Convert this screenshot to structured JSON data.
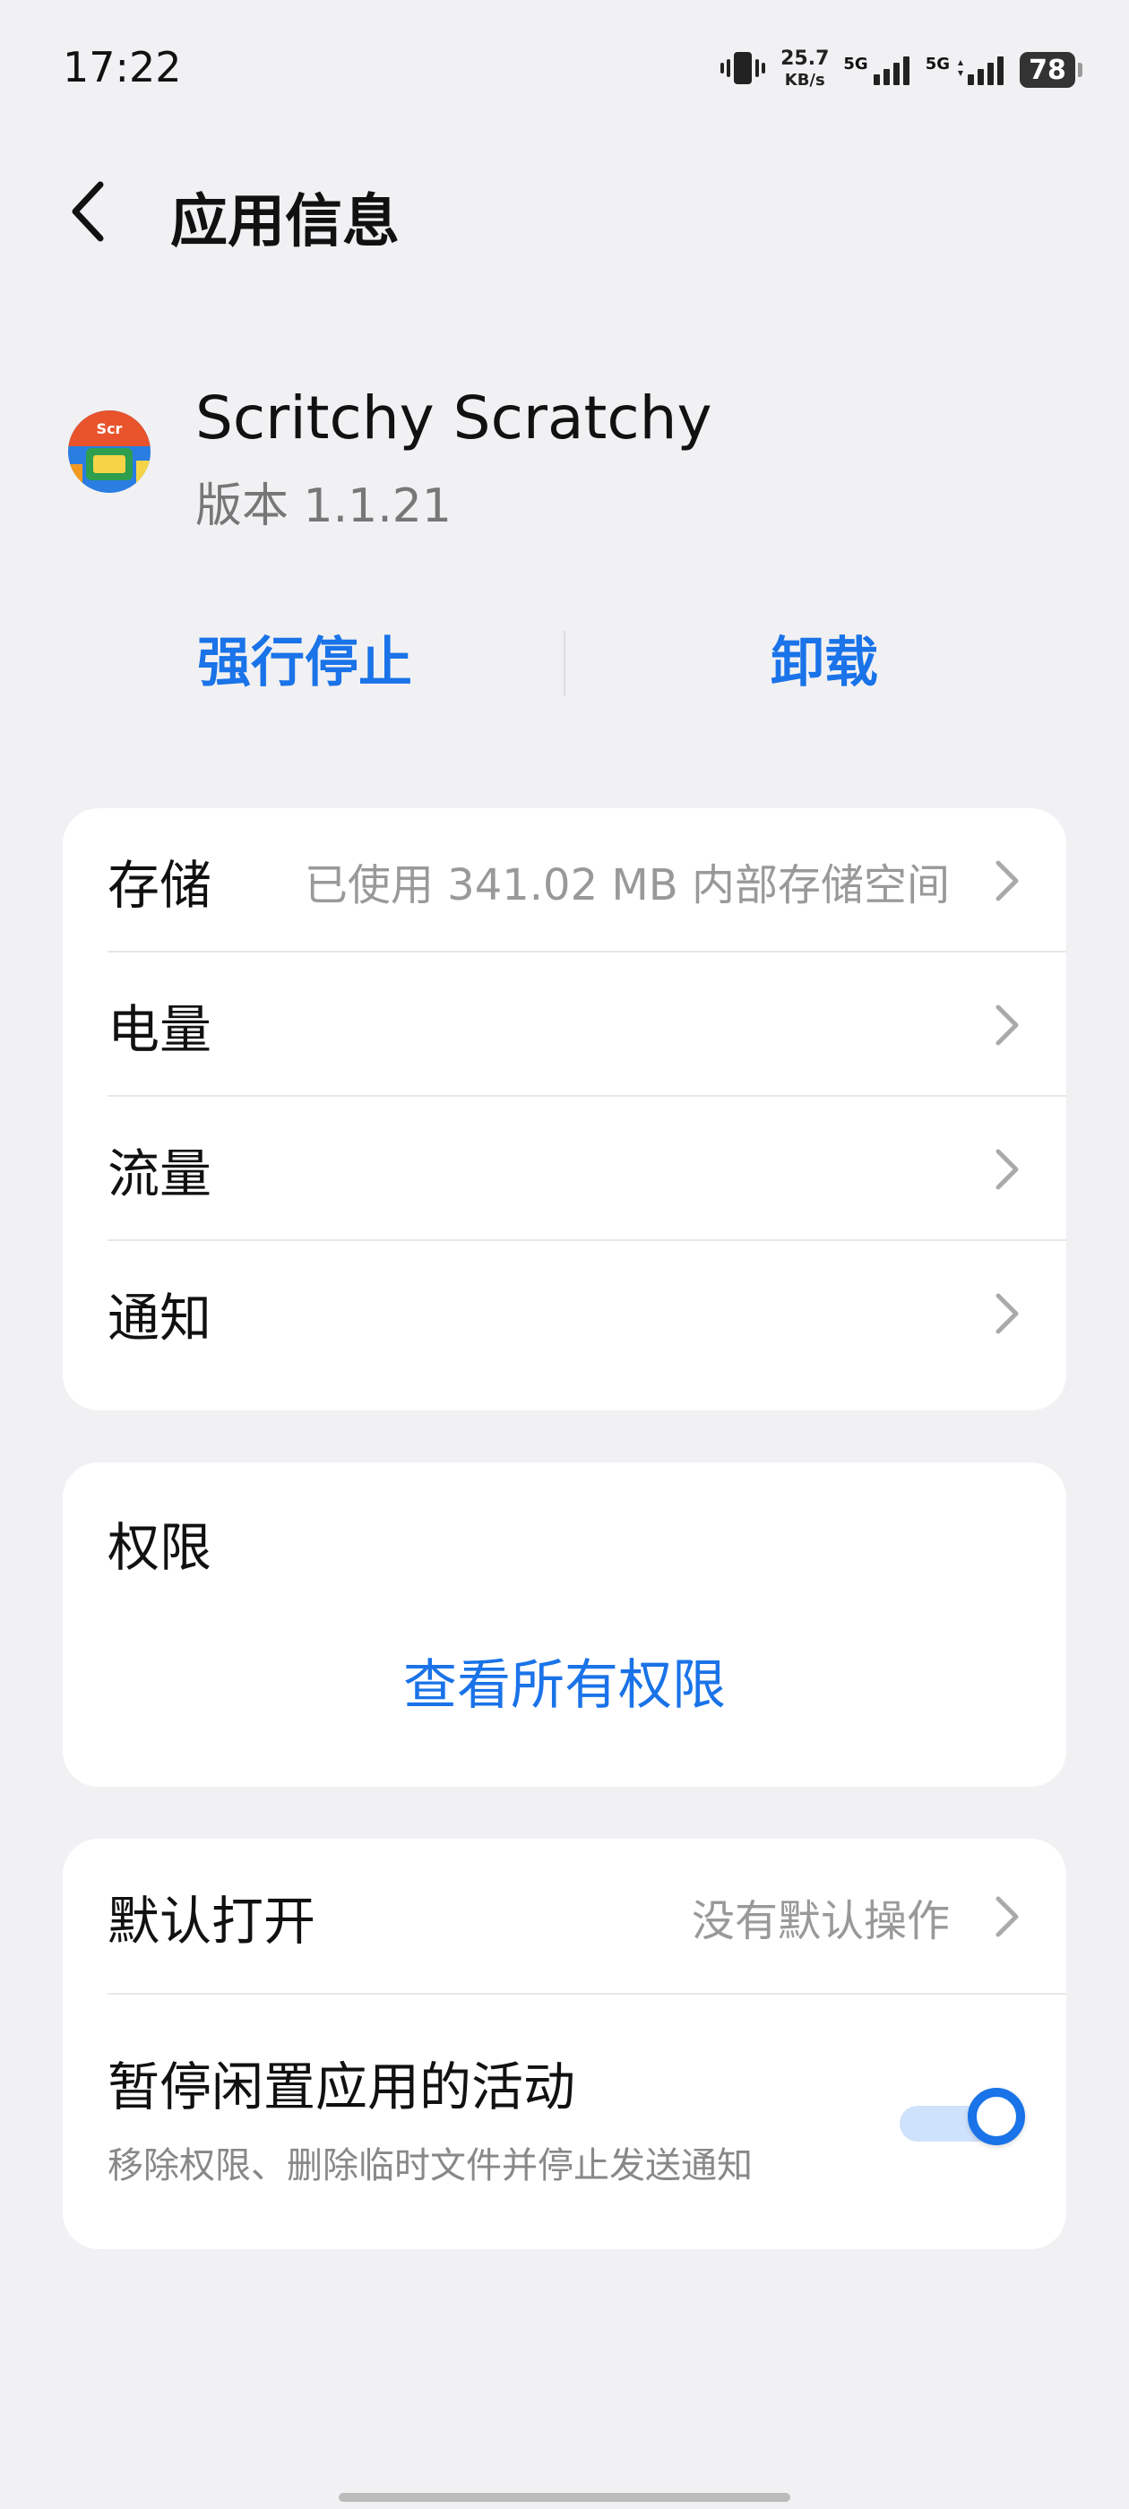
{
  "status_bar": {
    "time": "17:22",
    "net_speed_value": "25.7",
    "net_speed_unit": "KB/s",
    "sim1_label": "5G",
    "sim2_label": "5G",
    "battery": "78"
  },
  "header": {
    "title": "应用信息"
  },
  "app": {
    "name": "Scritchy Scratchy",
    "version": "版本 1.1.21"
  },
  "actions": {
    "force_stop": "强行停止",
    "uninstall": "卸载"
  },
  "usage_card": {
    "items": [
      {
        "label": "存储",
        "value": "已使用 341.02 MB 内部存储空间"
      },
      {
        "label": "电量",
        "value": ""
      },
      {
        "label": "流量",
        "value": ""
      },
      {
        "label": "通知",
        "value": ""
      }
    ]
  },
  "permissions_card": {
    "title": "权限",
    "link": "查看所有权限"
  },
  "defaults_card": {
    "open_by_default": {
      "label": "默认打开",
      "value": "没有默认操作"
    },
    "pause_activity": {
      "title": "暂停闲置应用的活动",
      "subtitle": "移除权限、删除临时文件并停止发送通知",
      "enabled": true
    }
  },
  "colors": {
    "accent": "#1a73e8",
    "background": "#f1f1f3",
    "card": "#ffffff"
  }
}
